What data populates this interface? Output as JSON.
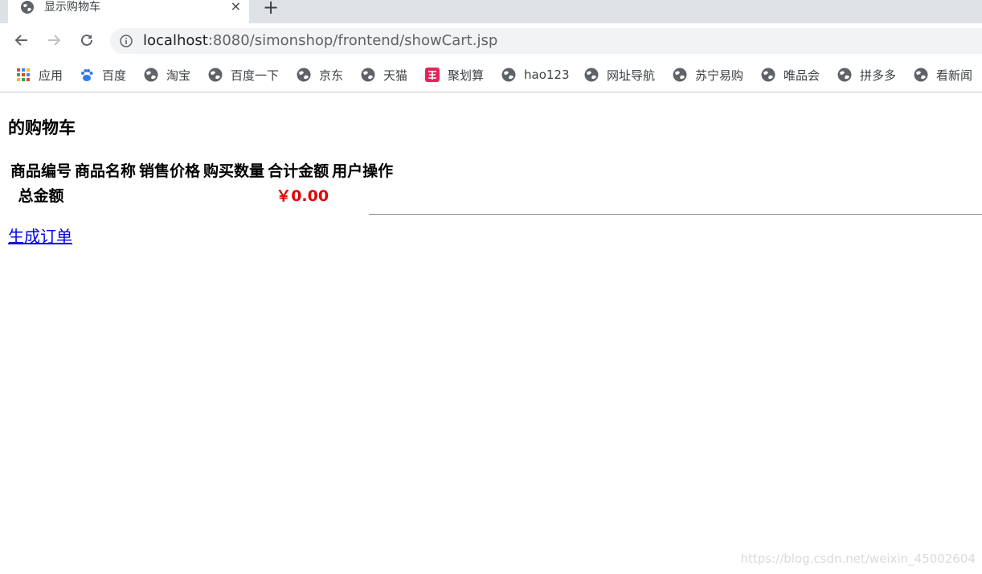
{
  "browser": {
    "tab": {
      "title": "显示购物车",
      "close": "×"
    },
    "new_tab": "+",
    "url_host": "localhost",
    "url_rest": ":8080/simonshop/frontend/showCart.jsp"
  },
  "bookmarks": [
    {
      "label": "应用",
      "icon": "apps-grid-icon"
    },
    {
      "label": "百度",
      "icon": "baidu-paw-icon"
    },
    {
      "label": "淘宝",
      "icon": "globe-icon"
    },
    {
      "label": "百度一下",
      "icon": "globe-icon"
    },
    {
      "label": "京东",
      "icon": "globe-icon"
    },
    {
      "label": "天猫",
      "icon": "globe-icon"
    },
    {
      "label": "聚划算",
      "icon": "juhuasuan-icon"
    },
    {
      "label": "hao123",
      "icon": "globe-icon"
    },
    {
      "label": "网址导航",
      "icon": "globe-icon"
    },
    {
      "label": "苏宁易购",
      "icon": "globe-icon"
    },
    {
      "label": "唯品会",
      "icon": "globe-icon"
    },
    {
      "label": "拼多多",
      "icon": "globe-icon"
    },
    {
      "label": "看新闻",
      "icon": "globe-icon"
    }
  ],
  "page": {
    "title": "的购物车",
    "table": {
      "headers": [
        "商品编号",
        "商品名称",
        "销售价格",
        "购买数量",
        "合计金额",
        "用户操作"
      ],
      "total_label": "总金额",
      "total_value": "￥0.00"
    },
    "order_link": "生成订单"
  },
  "watermark": "https://blog.csdn.net/weixin_45002604",
  "colors": {
    "total": "#e60000",
    "link": "#0000ee",
    "tabstrip": "#dee1e6"
  }
}
